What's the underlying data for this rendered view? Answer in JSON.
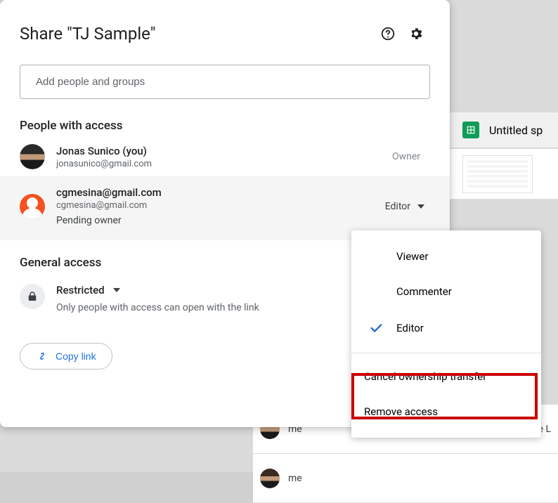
{
  "dialog": {
    "title": "Share \"TJ Sample\"",
    "add_placeholder": "Add people and groups",
    "people_header": "People with access",
    "owner_label": "Owner",
    "people": [
      {
        "name": "Jonas Sunico (you)",
        "email": "jonasunico@gmail.com",
        "role": "Owner"
      },
      {
        "name": "cgmesina@gmail.com",
        "email": "cgmesina@gmail.com",
        "role": "Editor",
        "status": "Pending owner"
      }
    ],
    "general_header": "General access",
    "general_mode": "Restricted",
    "general_sub": "Only people with access can open with the link",
    "copy_link": "Copy link"
  },
  "menu": {
    "viewer": "Viewer",
    "commenter": "Commenter",
    "editor": "Editor",
    "cancel_transfer": "Cancel ownership transfer",
    "remove": "Remove access"
  },
  "bg": {
    "file_title": "Untitled sp",
    "me": "me",
    "de": "De L"
  }
}
